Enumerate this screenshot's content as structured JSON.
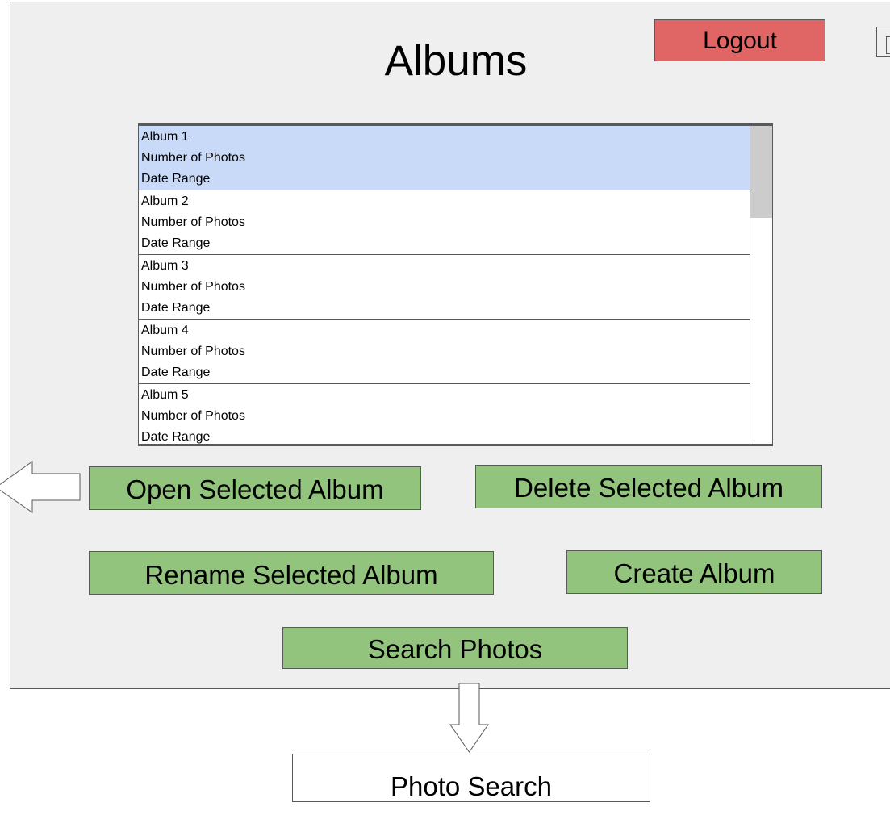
{
  "window": {
    "title": "Albums",
    "logout_label": "Logout"
  },
  "album_list": {
    "items": [
      {
        "name": "Album 1",
        "photos": "Number of Photos",
        "dates": "Date Range",
        "selected": true
      },
      {
        "name": "Album 2",
        "photos": "Number of Photos",
        "dates": "Date Range",
        "selected": false
      },
      {
        "name": "Album 3",
        "photos": "Number of Photos",
        "dates": "Date Range",
        "selected": false
      },
      {
        "name": "Album 4",
        "photos": "Number of Photos",
        "dates": "Date Range",
        "selected": false
      },
      {
        "name": "Album 5",
        "photos": "Number of Photos",
        "dates": "Date Range",
        "selected": false
      }
    ]
  },
  "actions": {
    "open_label": "Open Selected Album",
    "delete_label": "Delete Selected Album",
    "rename_label": "Rename Selected Album",
    "create_label": "Create Album",
    "search_label": "Search Photos"
  },
  "flow": {
    "photo_search_label": "Photo Search"
  },
  "colors": {
    "logout": "#e06666",
    "action": "#93c47d",
    "selected_row": "#c9daf8",
    "panel": "#efefef"
  }
}
